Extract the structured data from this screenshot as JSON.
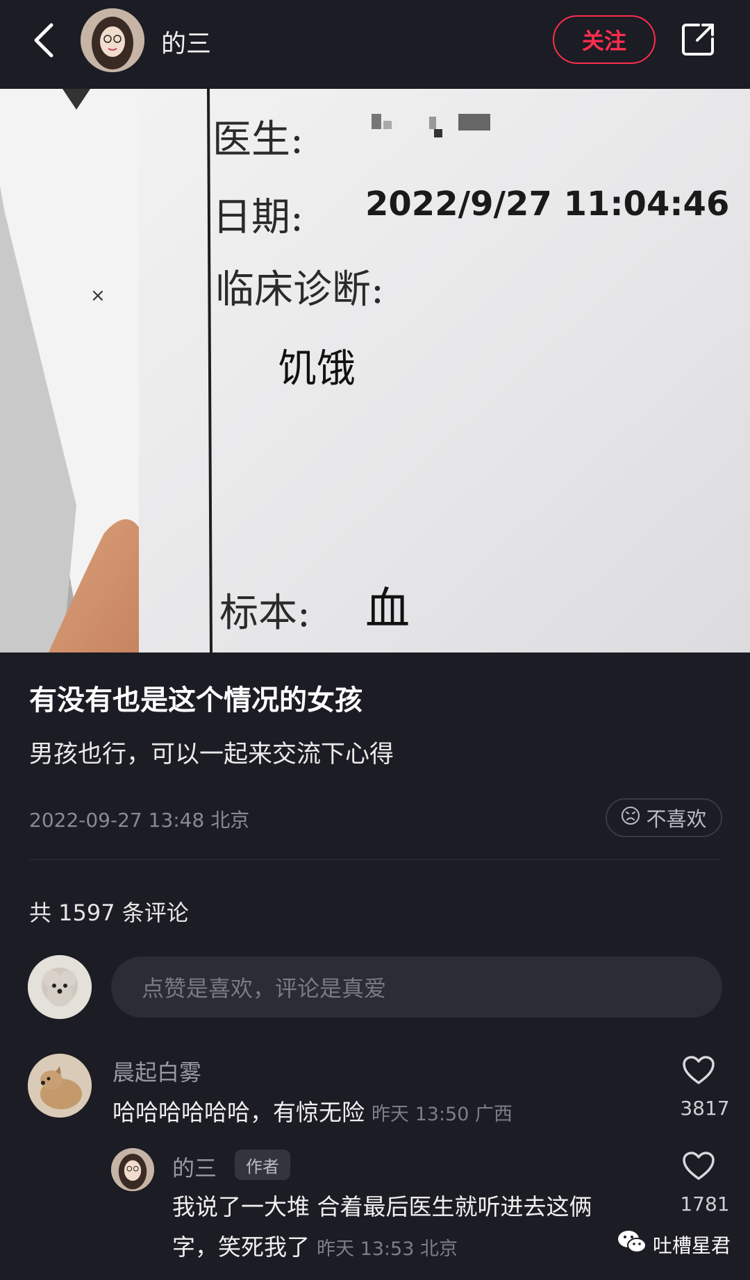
{
  "header": {
    "author_name": "的三",
    "follow_label": "关注"
  },
  "photo": {
    "doctor_label": "医生:",
    "date_label": "日期:",
    "date_value": "2022/9/27 11:04:46",
    "diagnosis_label": "临床诊断:",
    "diagnosis_value": "饥饿",
    "specimen_label": "标本:",
    "specimen_value": "血"
  },
  "post": {
    "title": "有没有也是这个情况的女孩",
    "description": "男孩也行，可以一起来交流下心得",
    "meta": "2022-09-27 13:48 北京",
    "dislike_label": "不喜欢"
  },
  "comments_section": {
    "count_text": "共 1597 条评论",
    "input_placeholder": "点赞是喜欢，评论是真爱"
  },
  "comments": [
    {
      "name": "晨起白雾",
      "text": "哈哈哈哈哈哈，有惊无险",
      "time": "昨天 13:50 广西",
      "likes": "3817"
    }
  ],
  "reply": {
    "name": "的三",
    "tag": "作者",
    "text_line1": "我说了一大堆 合着最后医生就听进去这俩",
    "text_line2": "字，笑死我了",
    "time": "昨天 13:53 北京",
    "likes": "1781"
  },
  "watermark": {
    "text": "吐槽星君"
  },
  "colors": {
    "background": "#1c1c24",
    "accent": "#ff2e4d",
    "input_bg": "#2c2c36"
  }
}
